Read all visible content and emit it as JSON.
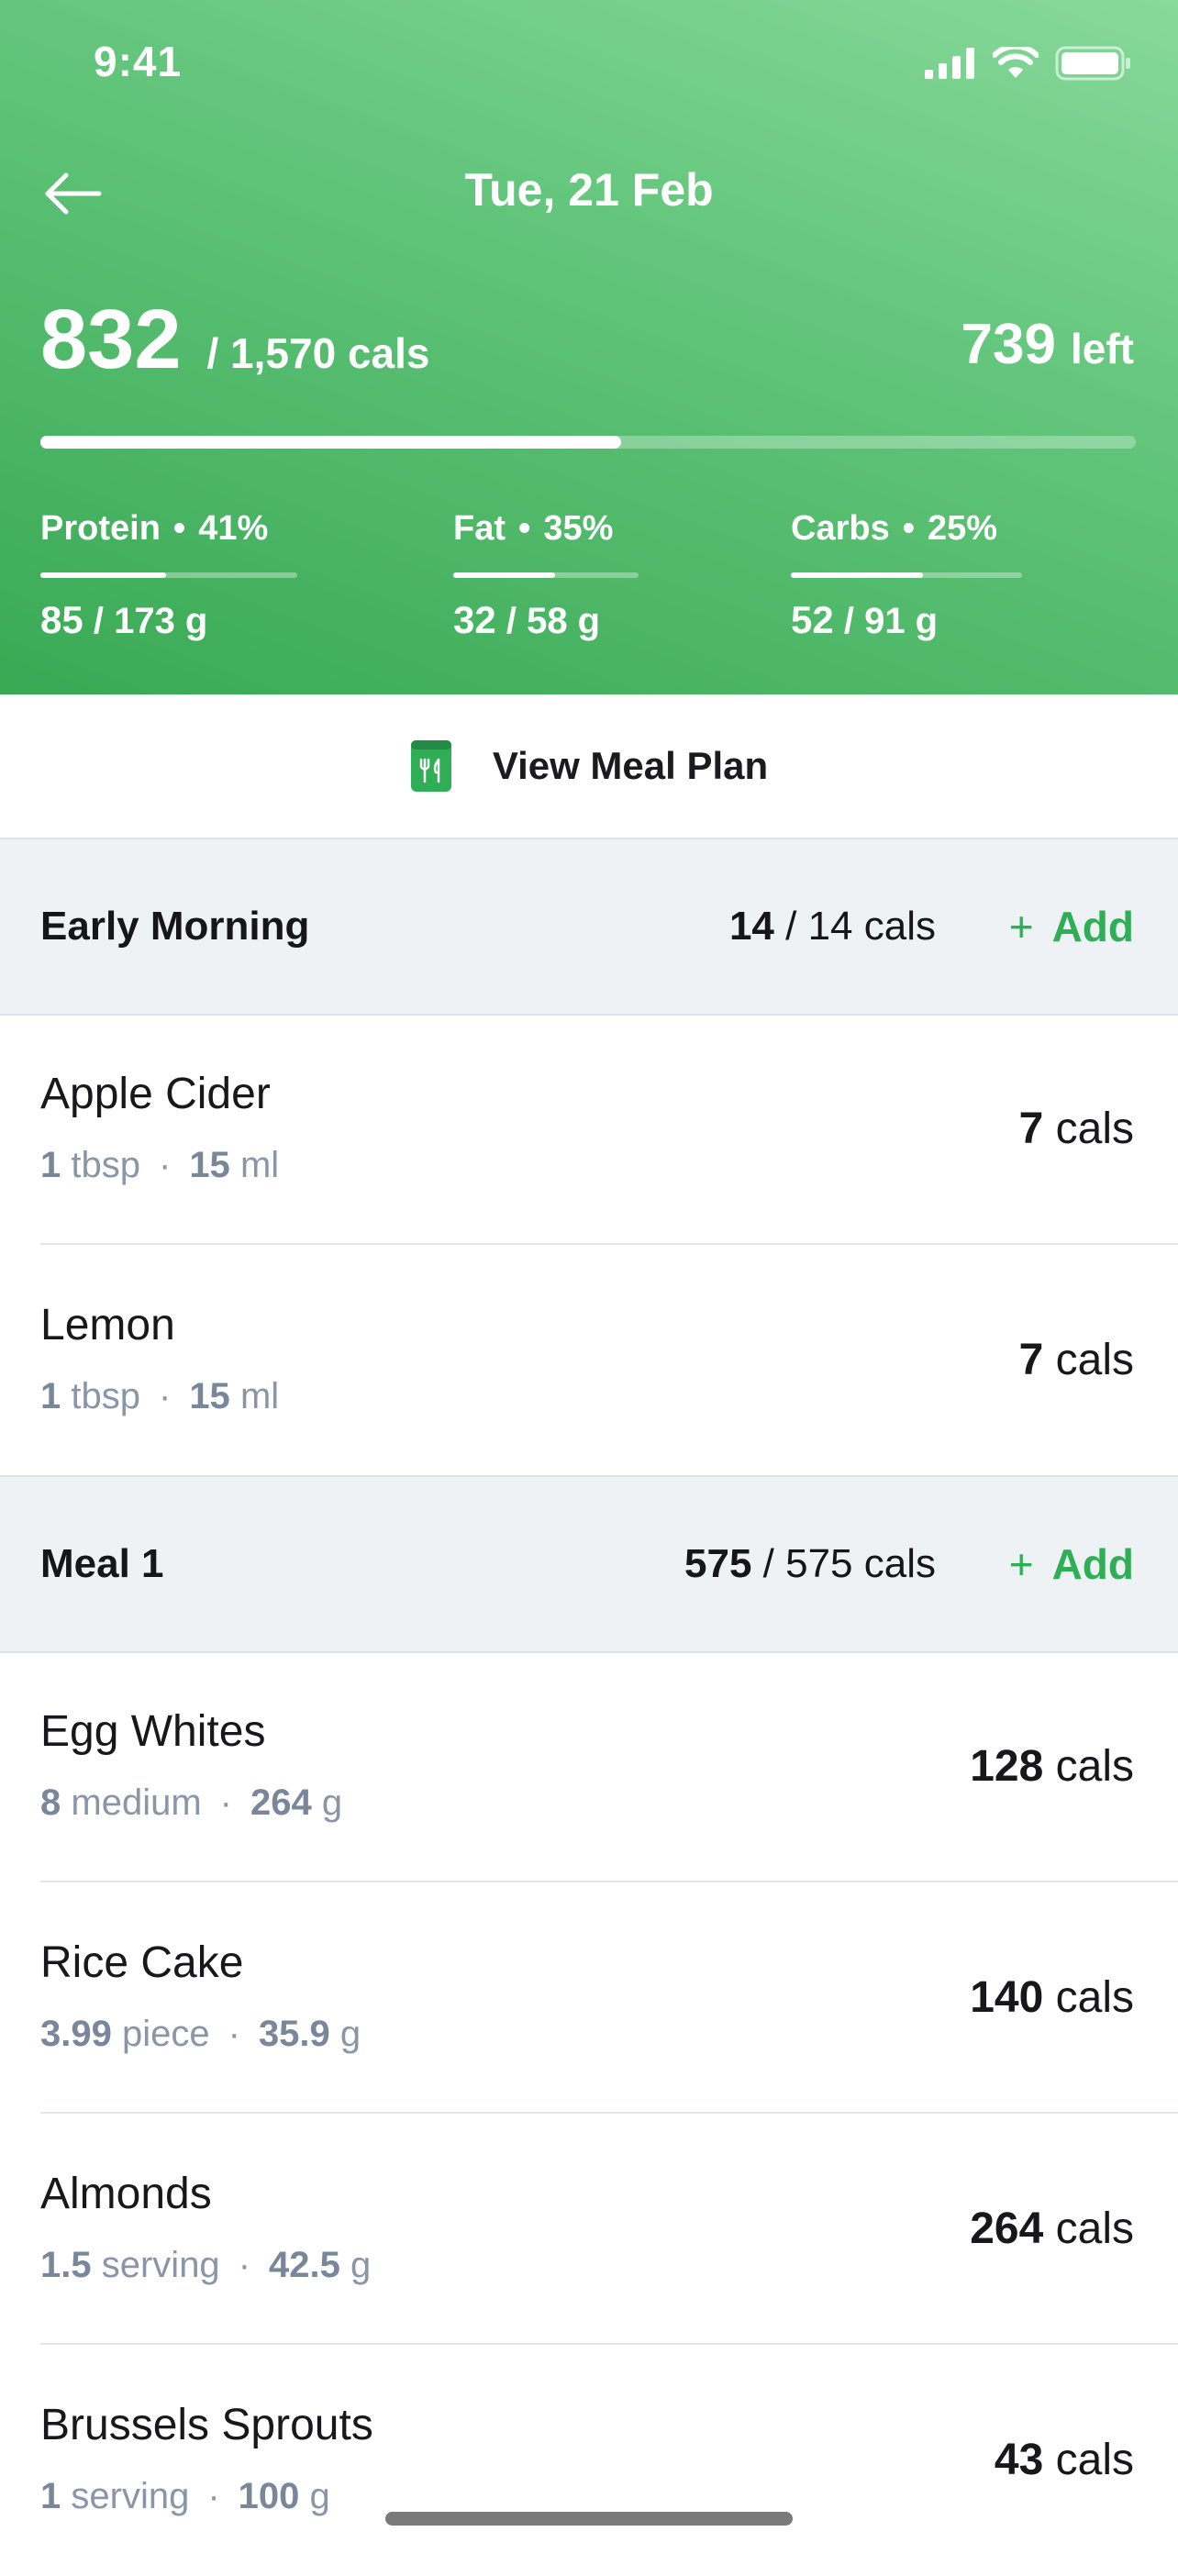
{
  "status_bar": {
    "time": "9:41"
  },
  "header": {
    "date_title": "Tue, 21 Feb",
    "calories_eaten": "832",
    "calories_goal": "/ 1,570 cals",
    "calories_left_value": "739",
    "calories_left_label": "left",
    "calorie_progress": 0.53,
    "macros": [
      {
        "name": "Protein",
        "percent": "41%",
        "current": "85",
        "goal": "/ 173 g",
        "progress": 0.49
      },
      {
        "name": "Fat",
        "percent": "35%",
        "current": "32",
        "goal": "/ 58 g",
        "progress": 0.55
      },
      {
        "name": "Carbs",
        "percent": "25%",
        "current": "52",
        "goal": "/ 91 g",
        "progress": 0.57
      }
    ]
  },
  "meal_plan_button": {
    "label": "View Meal Plan"
  },
  "sections": [
    {
      "title": "Early Morning",
      "cals_current": "14",
      "cals_goal": "/ 14 cals",
      "add_label": "Add",
      "items": [
        {
          "name": "Apple Cider",
          "qty_num": "1",
          "qty_unit": "tbsp",
          "weight_num": "15",
          "weight_unit": "ml",
          "cals_num": "7",
          "cals_unit": "cals"
        },
        {
          "name": "Lemon",
          "qty_num": "1",
          "qty_unit": "tbsp",
          "weight_num": "15",
          "weight_unit": "ml",
          "cals_num": "7",
          "cals_unit": "cals"
        }
      ]
    },
    {
      "title": "Meal 1",
      "cals_current": "575",
      "cals_goal": "/ 575 cals",
      "add_label": "Add",
      "items": [
        {
          "name": "Egg Whites",
          "qty_num": "8",
          "qty_unit": "medium",
          "weight_num": "264",
          "weight_unit": "g",
          "cals_num": "128",
          "cals_unit": "cals"
        },
        {
          "name": "Rice Cake",
          "qty_num": "3.99",
          "qty_unit": "piece",
          "weight_num": "35.9",
          "weight_unit": "g",
          "cals_num": "140",
          "cals_unit": "cals"
        },
        {
          "name": "Almonds",
          "qty_num": "1.5",
          "qty_unit": "serving",
          "weight_num": "42.5",
          "weight_unit": "g",
          "cals_num": "264",
          "cals_unit": "cals"
        },
        {
          "name": "Brussels Sprouts",
          "qty_num": "1",
          "qty_unit": "serving",
          "weight_num": "100",
          "weight_unit": "g",
          "cals_num": "43",
          "cals_unit": "cals"
        }
      ]
    }
  ],
  "colors": {
    "accent_green": "#2fae56",
    "header_gradient_top": "#88d99a",
    "header_gradient_bottom": "#39a954",
    "section_bg": "#eef2f5",
    "secondary_text": "#8a96a8"
  }
}
